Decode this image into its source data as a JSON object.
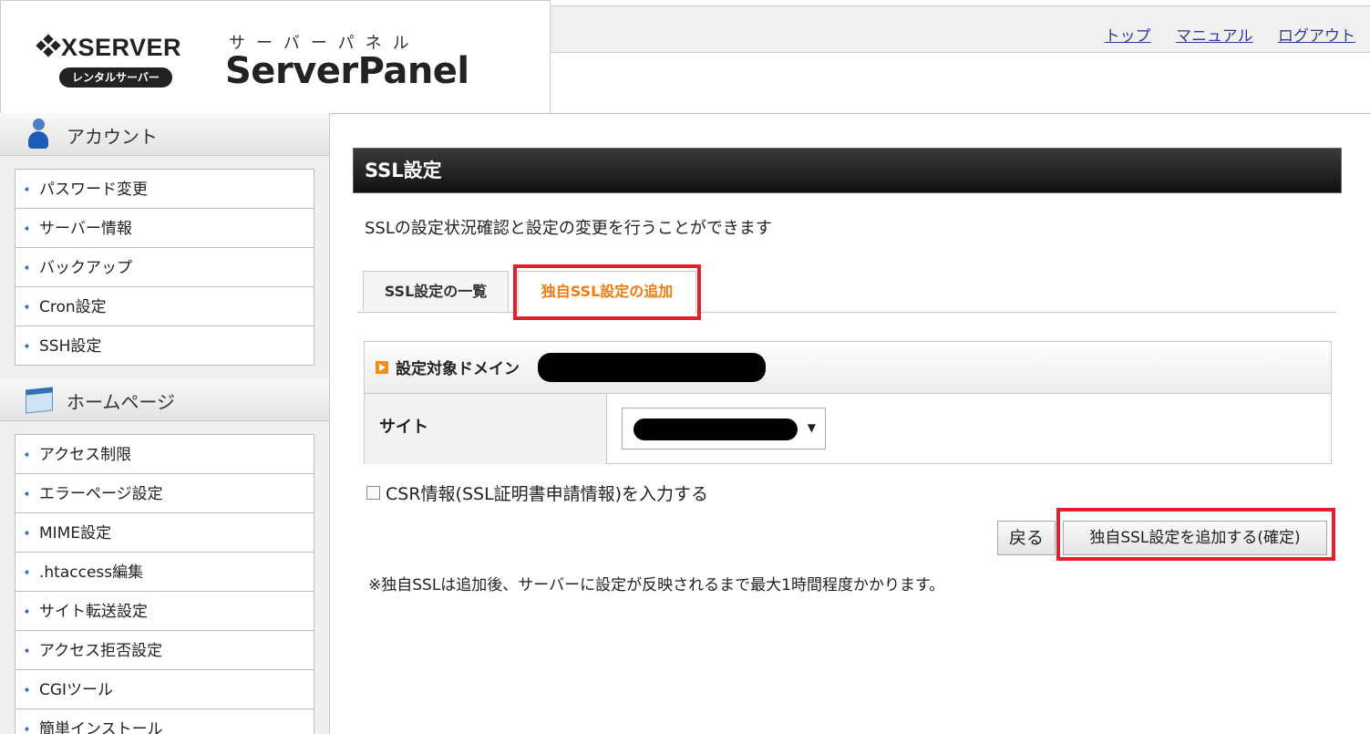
{
  "header": {
    "brand": "XSERVER",
    "brand_badge": "レンタルサーバー",
    "product_kana": "サーバーパネル",
    "product_name": "ServerPanel",
    "links": {
      "top": "トップ",
      "manual": "マニュアル",
      "logout": "ログアウト"
    }
  },
  "sidebar": {
    "account": {
      "title": "アカウント",
      "items": [
        "パスワード変更",
        "サーバー情報",
        "バックアップ",
        "Cron設定",
        "SSH設定"
      ]
    },
    "homepage": {
      "title": "ホームページ",
      "items": [
        "アクセス制限",
        "エラーページ設定",
        "MIME設定",
        ".htaccess編集",
        "サイト転送設定",
        "アクセス拒否設定",
        "CGIツール",
        "簡単インストール"
      ]
    }
  },
  "main": {
    "title": "SSL設定",
    "description": "SSLの設定状況確認と設定の変更を行うことができます",
    "tabs": {
      "list": "SSL設定の一覧",
      "add": "独自SSL設定の追加"
    },
    "form": {
      "domain_label": "設定対象ドメイン",
      "site_label": "サイト"
    },
    "csr_label": "CSR情報(SSL証明書申請情報)を入力する",
    "back_button": "戻る",
    "confirm_button": "独自SSL設定を追加する(確定)",
    "note": "※独自SSLは追加後、サーバーに設定が反映されるまで最大1時間程度かかります。"
  },
  "colors": {
    "accent_orange": "#f07c10",
    "highlight_red": "#e0202a",
    "link_blue": "#2a3c9e"
  }
}
